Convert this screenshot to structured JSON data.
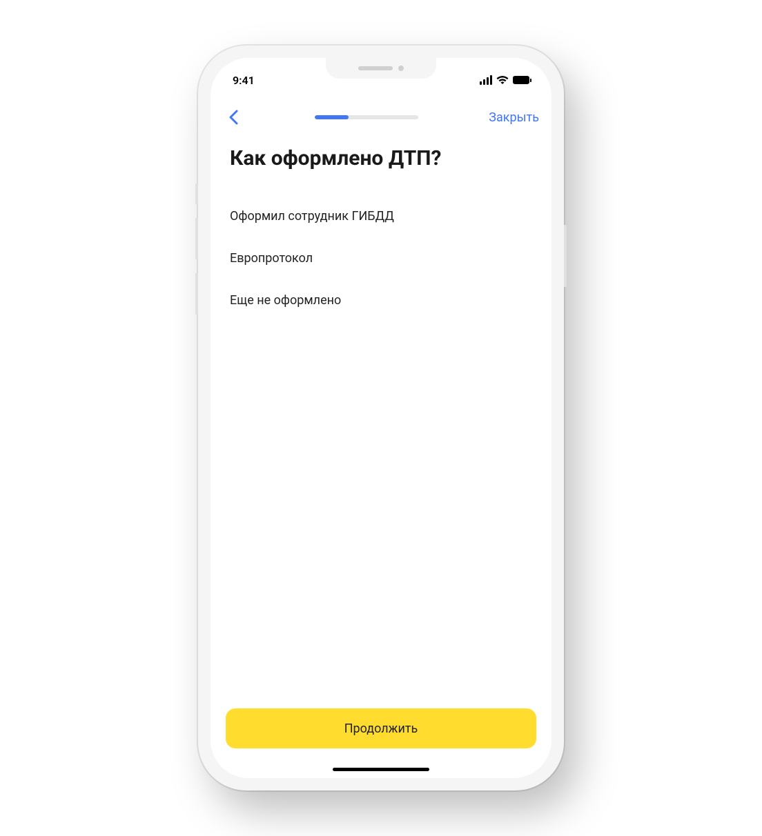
{
  "statusBar": {
    "time": "9:41"
  },
  "navBar": {
    "close": "Закрыть",
    "progressPercent": 33
  },
  "page": {
    "title": "Как оформлено ДТП?"
  },
  "options": [
    {
      "label": "Оформил сотрудник ГИБДД"
    },
    {
      "label": "Европротокол"
    },
    {
      "label": "Еще не оформлено"
    }
  ],
  "actions": {
    "continue": "Продолжить"
  },
  "colors": {
    "accent": "#4176f4",
    "primaryButton": "#ffdc2d"
  }
}
